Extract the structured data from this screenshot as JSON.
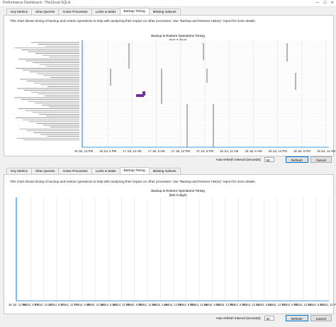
{
  "window": {
    "title": "Performance Dashboard - TheCloud SQLA",
    "minimize": "—",
    "maximize": "☐",
    "close": "✕"
  },
  "panels": [
    {
      "tabs": [
        "Key Metrics",
        "Slow Queries",
        "Active Processes",
        "Locks & Waits",
        "Backup Timing",
        "Missing Indexes"
      ],
      "active_tab": "Backup Timing",
      "description": "This chart shows timing of backup and restore operations to help with analyzing their impact on other processes. Use \"Backup and Restore History\" report for more details.",
      "chart_title_line1": "Backup & Restore Operations Timing",
      "chart_title_line2": "(last 3 days)",
      "refresh_label": "Auto-refresh interval (seconds):",
      "refresh_value": "60",
      "refresh_button": "Refresh",
      "cancel_button": "Cancel"
    },
    {
      "tabs": [
        "Key Metrics",
        "Slow Queries",
        "Active Processes",
        "Locks & Waits",
        "Backup Timing",
        "Missing Indexes"
      ],
      "active_tab": "Backup Timing",
      "description": "This chart shows timing of backup and restore operations to help with analyzing their impact on other processes. Use \"Backup and Restore History\" report for more details.",
      "chart_title_line1": "Backup & Restore Operations Timing",
      "chart_title_line2": "(last 3 days)",
      "refresh_label": "Auto-refresh interval (seconds):",
      "refresh_value": "60",
      "refresh_button": "Refresh",
      "cancel_button": "Cancel"
    }
  ],
  "colors": {
    "accent": "#0078d7",
    "series_highlight": "#7030a0",
    "gridline": "#e0e0e0"
  },
  "chart_data": [
    {
      "type": "timeline",
      "title": "Backup & Restore Operations Timing",
      "subtitle": "(last 3 days)",
      "x_tick_labels": [
        "16 Jul, 12 PM",
        "16 Jul, 6 PM",
        "17 Jul, 12 AM",
        "17 Jul, 6 AM",
        "17 Jul, 12 PM",
        "17 Jul, 6 PM",
        "18 Jul, 12 AM",
        "18 Jul, 6 AM",
        "18 Jul, 12 PM",
        "18 Jul, 6 PM",
        "19 Jul, 12 AM"
      ],
      "grid": true
    },
    {
      "type": "timeline",
      "title": "Backup & Restore Operations Timing",
      "subtitle": "(last 3 days)",
      "x_tick_labels": [
        "16 Jul, 12 PM",
        "16 Jul, 6 PM",
        "17 Jul, 12 AM",
        "17 Jul, 6 AM",
        "17 Jul, 12 PM",
        "17 Jul, 6 PM",
        "18 Jul, 12 AM",
        "18 Jul, 6 AM",
        "18 Jul, 12 PM",
        "18 Jul, 6 PM",
        "19 Jul, 12 AM",
        "19 Jul, 6 AM",
        "19 Jul, 12 PM",
        "19 Jul, 6 PM",
        "20 Jul, 12 AM",
        "20 Jul, 6 AM",
        "20 Jul, 12 PM",
        "20 Jul, 6 PM",
        "21 Jul, 12 AM",
        "21 Jul, 6 AM",
        "21 Jul, 12 PM",
        "21 Jul, 6 PM",
        "22 Jul, 12 AM",
        "22 Jul, 6 AM",
        "22 Jul, 12 PM"
      ],
      "grid": true
    }
  ]
}
